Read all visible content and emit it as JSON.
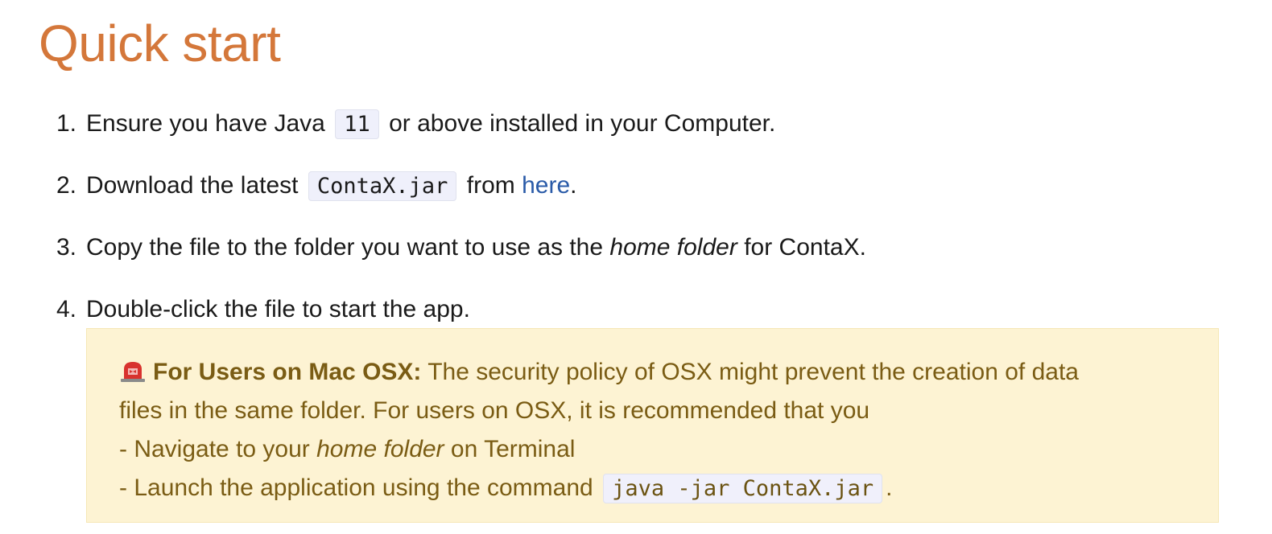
{
  "title": "Quick start",
  "steps": [
    {
      "num": "1.",
      "pre": "Ensure you have Java",
      "code": "11",
      "post": "or above installed in your Computer."
    },
    {
      "num": "2.",
      "pre": "Download the latest",
      "code": "ContaX.jar",
      "mid": "from",
      "link": "here",
      "post": "."
    },
    {
      "num": "3.",
      "pre": "Copy the file to the folder you want to use as the",
      "em": "home folder",
      "post": "for ContaX."
    },
    {
      "num": "4.",
      "text": "Double-click the file to start the app."
    }
  ],
  "callout": {
    "icon": "rotating-light-icon",
    "heading": "For Users on Mac OSX:",
    "line1": "The security policy of OSX might prevent the creation of data",
    "line2": "files in the same folder. For users on OSX, it is recommended that you",
    "line3_pre": "- Navigate to your",
    "line3_em": "home folder",
    "line3_post": "on Terminal",
    "line4_pre": "- Launch the application using the command",
    "line4_code": "java -jar ContaX.jar",
    "line4_post": "."
  },
  "colors": {
    "title": "#d4773a",
    "link": "#2a5ba8",
    "callout_bg": "#fdf3d3",
    "callout_text": "#7a5c14",
    "code_bg": "#eff0fb"
  }
}
